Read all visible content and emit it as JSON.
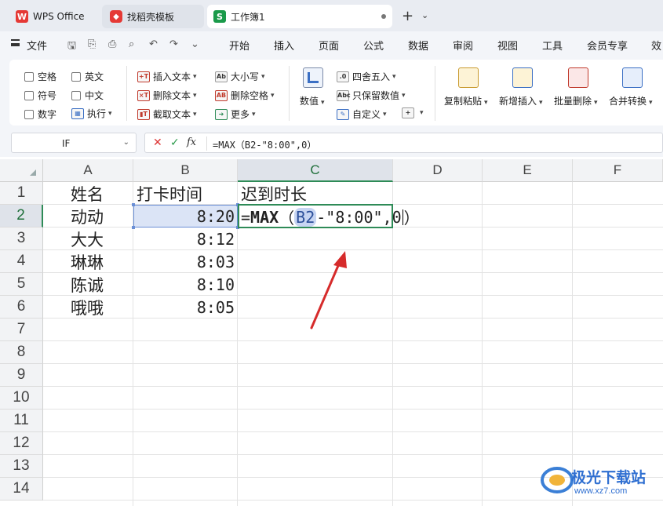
{
  "tabs": [
    {
      "label": "WPS Office",
      "logo": "W"
    },
    {
      "label": "找稻壳模板"
    },
    {
      "label": "工作簿1",
      "logo": "S"
    }
  ],
  "menu": {
    "file": "文件",
    "items": [
      "开始",
      "插入",
      "页面",
      "公式",
      "数据",
      "审阅",
      "视图",
      "工具",
      "会员专享",
      "效"
    ]
  },
  "ribbon": {
    "checkboxes": [
      "空格",
      "英文",
      "符号",
      "中文",
      "数字"
    ],
    "exec": "执行",
    "insert_text": "插入文本",
    "delete_text": "删除文本",
    "extract_text": "截取文本",
    "case": "大小写",
    "delete_space": "删除空格",
    "more": "更多",
    "numeric": "数值",
    "round": "四舍五入",
    "keep_numeric": "只保留数值",
    "custom": "自定义",
    "copy_paste": "复制粘贴",
    "add_insert": "新增插入",
    "batch_delete": "批量删除",
    "merge_convert": "合并转换"
  },
  "formula_bar": {
    "name_box": "IF",
    "formula": "=MAX（B2-\"8:00\",0）"
  },
  "columns": [
    "A",
    "B",
    "C",
    "D",
    "E",
    "F"
  ],
  "rows": [
    "1",
    "2",
    "3",
    "4",
    "5",
    "6",
    "7",
    "8",
    "9",
    "10",
    "11",
    "12",
    "13",
    "14"
  ],
  "cells": {
    "A1": "姓名",
    "B1": "打卡时间",
    "C1": "迟到时长",
    "A2": "动动",
    "B2": "8:20",
    "A3": "大大",
    "B3": "8:12",
    "A4": "琳琳",
    "B4": "8:03",
    "A5": "陈诚",
    "B5": "8:10",
    "A6": "哦哦",
    "B6": "8:05"
  },
  "editing": {
    "prefix": "=",
    "func": "MAX",
    "open": "（",
    "ref": "B2",
    "rest": "-\"8:00\",0",
    "close": "）"
  },
  "watermark": {
    "title": "极光下载站",
    "url": "www.xz7.com"
  }
}
